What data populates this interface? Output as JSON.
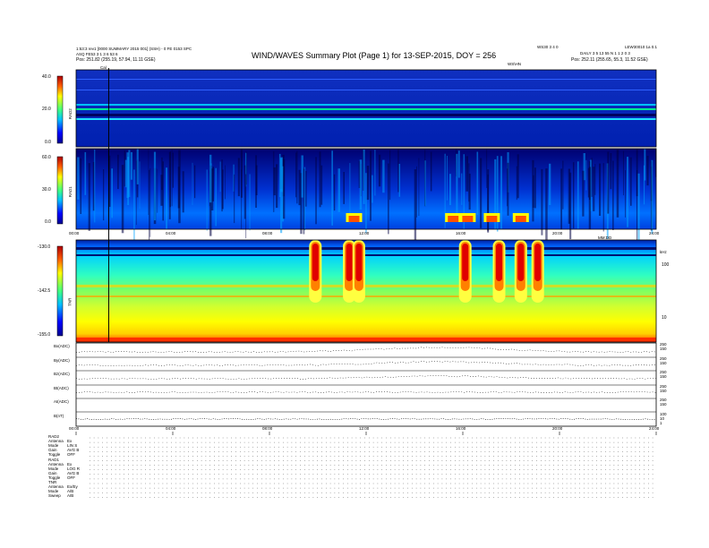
{
  "header": {
    "title": "WIND/WAVES Summary Plot (Page 1) for 13-SEP-2015, DOY = 256",
    "left_line1": "1:53:3 rev1 [0000 SUMMARY 2015 001] (SSH) - 0 FE 0153 SPC",
    "left_line2": "ASQ FE53 3 1 3 6 53 6",
    "left_pos": "Pos:  251.82 (255.19, 57.94, 11.11 GSE)",
    "right_line1": "LEW30010 1a 0.1",
    "right_line2": "DAILY 3 5 13 55 N 1 1 2 0 3",
    "right_pos": "Pos:  252.11 (255.65, 55.3, 11.52 GSE)",
    "center_code": "WS30 3 4 0",
    "center_label": "WS\\HN",
    "cal_marker": "Cal"
  },
  "colors": {
    "background": "#000080",
    "heat_low": "#0030ff",
    "heat_high": "#ff0000"
  },
  "panels": {
    "rad2": {
      "label": "RAD2",
      "ticks": [
        "40.0",
        "20.0",
        "0.0"
      ]
    },
    "rad1": {
      "label": "RAD1",
      "ticks": [
        "60.0",
        "30.0",
        "0.0"
      ]
    },
    "tnr": {
      "label": "TNR",
      "ticks": [
        "-130.0",
        "-142.5",
        "-155.0"
      ],
      "right_ticks": [
        "100",
        "10"
      ],
      "right_label": "kHz"
    },
    "time_axis": [
      "00:00",
      "04:00",
      "08:00",
      "12:00",
      "16:00",
      "20:00",
      "24:00"
    ],
    "time_axis_title": "MM:DD",
    "line_panels": [
      {
        "label": "Bx(ADC)",
        "scale": [
          "250",
          "150"
        ]
      },
      {
        "label": "By(ADC)",
        "scale": [
          "250",
          "150"
        ]
      },
      {
        "label": "Bz(ADC)",
        "scale": [
          "250",
          "150"
        ]
      },
      {
        "label": "Bt(ADC)",
        "scale": [
          "250",
          "150"
        ]
      },
      {
        "label": "At(ADC)",
        "scale": [
          "250",
          "150"
        ]
      },
      {
        "label": "B(nT)",
        "scale": [
          "100",
          "10",
          "1"
        ]
      }
    ]
  },
  "footer": {
    "rows": [
      {
        "k": "RAD2",
        "v": ""
      },
      {
        "k": "Antenna",
        "v": "Ex"
      },
      {
        "k": "Mode",
        "v": "LIN S"
      },
      {
        "k": "Gain",
        "v": "AVG B"
      },
      {
        "k": "Toggle",
        "v": "OFF"
      },
      {
        "k": "RAD1",
        "v": ""
      },
      {
        "k": "Antenna",
        "v": "Ex"
      },
      {
        "k": "Mode",
        "v": "LOG R"
      },
      {
        "k": "Gain",
        "v": "AVG B"
      },
      {
        "k": "Toggle",
        "v": "OFF"
      },
      {
        "k": "TNR",
        "v": ""
      },
      {
        "k": "Antenna",
        "v": "Ex/Ey"
      },
      {
        "k": "Mode",
        "v": "A/B"
      },
      {
        "k": "Sweep",
        "v": "A/B"
      }
    ]
  },
  "chart_data": {
    "type": "heatmap",
    "title": "WIND/WAVES Summary Plot (Page 1) for 13-SEP-2015, DOY = 256",
    "x_range": [
      0,
      24
    ],
    "rad2_range": [
      0,
      40
    ],
    "rad1_range": [
      0,
      60
    ],
    "tnr_range": [
      -155,
      -130
    ],
    "cal_hour": 1.35,
    "tnr_events": [
      {
        "hour": 9.9,
        "level": "red"
      },
      {
        "hour": 11.3,
        "level": "red"
      },
      {
        "hour": 11.7,
        "level": "red"
      },
      {
        "hour": 16.1,
        "level": "red"
      },
      {
        "hour": 17.5,
        "level": "red"
      },
      {
        "hour": 18.4,
        "level": "red"
      },
      {
        "hour": 19.1,
        "level": "red"
      }
    ],
    "rad1_events": [
      {
        "hour": 11.5,
        "level": "red"
      },
      {
        "hour": 15.6,
        "level": "red"
      },
      {
        "hour": 16.2,
        "level": "red"
      },
      {
        "hour": 17.2,
        "level": "red"
      },
      {
        "hour": 18.4,
        "level": "red"
      }
    ]
  }
}
